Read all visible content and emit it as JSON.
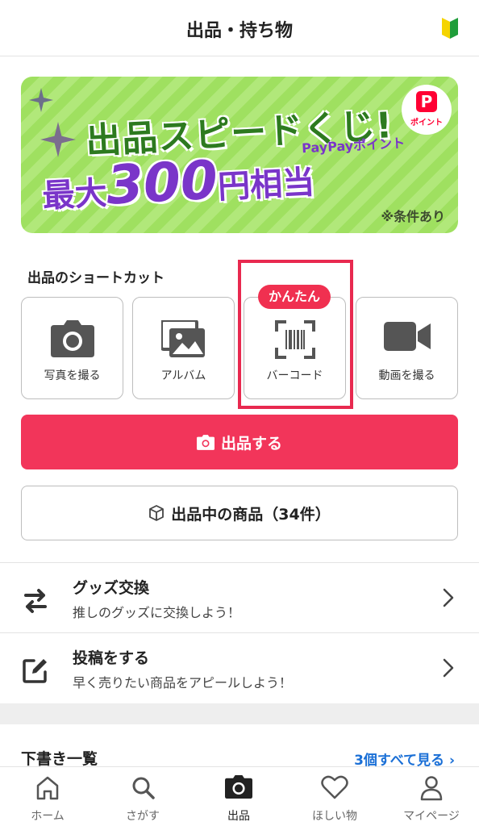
{
  "header": {
    "title": "出品・持ち物"
  },
  "banner": {
    "title": "出品スピードくじ!",
    "subtitle": "PayPayポイント",
    "amount_prefix": "最大",
    "amount_value": "300",
    "amount_suffix": "円相当",
    "note": "※条件あり",
    "badge_letter": "P",
    "badge_label": "ポイント"
  },
  "shortcuts": {
    "heading": "出品のショートカット",
    "badge": "かんたん",
    "items": [
      {
        "label": "写真を撮る",
        "icon": "camera-icon"
      },
      {
        "label": "アルバム",
        "icon": "album-icon"
      },
      {
        "label": "バーコード",
        "icon": "barcode-scan-icon"
      },
      {
        "label": "動画を撮る",
        "icon": "video-camera-icon"
      }
    ]
  },
  "actions": {
    "sell_label": "出品する",
    "listed_label": "出品中の商品（34件）"
  },
  "menu": [
    {
      "title": "グッズ交換",
      "subtitle": "推しのグッズに交換しよう！",
      "icon": "swap-arrows-icon"
    },
    {
      "title": "投稿をする",
      "subtitle": "早く売りたい商品をアピールしよう！",
      "icon": "edit-post-icon"
    }
  ],
  "drafts": {
    "title": "下書き一覧",
    "link": "3個すべて見る"
  },
  "bottom_nav": [
    {
      "label": "ホーム",
      "icon": "home-icon"
    },
    {
      "label": "さがす",
      "icon": "search-icon"
    },
    {
      "label": "出品",
      "icon": "camera-icon"
    },
    {
      "label": "ほしい物",
      "icon": "heart-icon"
    },
    {
      "label": "マイページ",
      "icon": "person-icon"
    }
  ],
  "colors": {
    "primary": "#f2355a",
    "banner_green": "#9fe060",
    "banner_purple": "#7a35c9",
    "link_blue": "#1a6fd6"
  }
}
